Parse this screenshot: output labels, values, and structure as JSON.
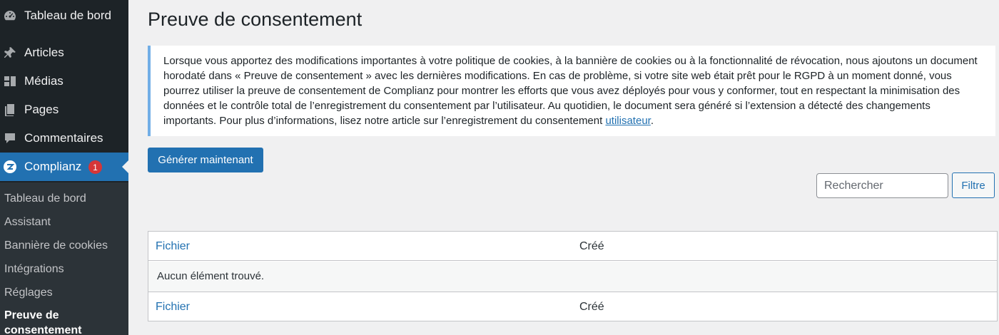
{
  "sidebar": {
    "items": [
      {
        "label": "Tableau de bord",
        "icon": "dashboard-icon"
      },
      {
        "label": "Articles",
        "icon": "pushpin-icon"
      },
      {
        "label": "Médias",
        "icon": "media-icon"
      },
      {
        "label": "Pages",
        "icon": "pages-icon"
      },
      {
        "label": "Commentaires",
        "icon": "comment-icon"
      },
      {
        "label": "Complianz",
        "icon": "complianz-icon",
        "badge": "1"
      }
    ],
    "submenu": [
      {
        "label": "Tableau de bord"
      },
      {
        "label": "Assistant"
      },
      {
        "label": "Bannière de cookies"
      },
      {
        "label": "Intégrations"
      },
      {
        "label": "Réglages"
      },
      {
        "label_line1": "Preuve de",
        "label_line2": "consentement"
      }
    ]
  },
  "main": {
    "title": "Preuve de consentement",
    "notice": {
      "text": "Lorsque vous apportez des modifications importantes à votre politique de cookies, à la bannière de cookies ou à la fonctionnalité de révocation, nous ajoutons un document horodaté dans « Preuve de consentement » avec les dernières modifications. En cas de problème, si votre site web était prêt pour le RGPD à un moment donné, vous pourrez utiliser la preuve de consentement de Complianz pour montrer les efforts que vous avez déployés pour vous y conformer, tout en respectant la minimisation des données et le contrôle total de l’enregistrement du consentement par l’utilisateur. Au quotidien, le document sera généré si l’extension a détecté des changements importants. Pour plus d’informations, lisez notre article sur l’enregistrement du consentement ",
      "link": "utilisateur",
      "tail": "."
    },
    "generate_label": "Générer maintenant",
    "search_placeholder": "Rechercher",
    "filter_label": "Filtre",
    "table": {
      "columns": [
        "Fichier",
        "Créé"
      ],
      "empty_text": "Aucun élément trouvé."
    }
  },
  "colors": {
    "sidebar_bg": "#1d2327",
    "submenu_bg": "#2c3338",
    "accent": "#2271b1",
    "badge": "#d63638",
    "notice_border": "#72aee6"
  }
}
